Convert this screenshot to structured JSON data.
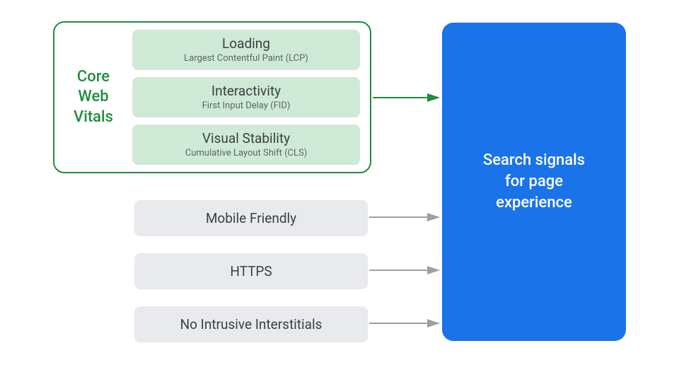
{
  "cwv": {
    "label_line1": "Core",
    "label_line2": "Web",
    "label_line3": "Vitals",
    "metrics": [
      {
        "title": "Loading",
        "sub": "Largest Contentful Paint (LCP)"
      },
      {
        "title": "Interactivity",
        "sub": "First Input Delay (FID)"
      },
      {
        "title": "Visual Stability",
        "sub": "Cumulative Layout Shift (CLS)"
      }
    ]
  },
  "signals": {
    "mobile": "Mobile Friendly",
    "https": "HTTPS",
    "interstitials": "No Intrusive Interstitials"
  },
  "target": {
    "line1": "Search signals",
    "line2": "for page",
    "line3": "experience"
  },
  "colors": {
    "green": "#1e8e3e",
    "grey": "#9aa0a6",
    "blue": "#1a73e8"
  }
}
